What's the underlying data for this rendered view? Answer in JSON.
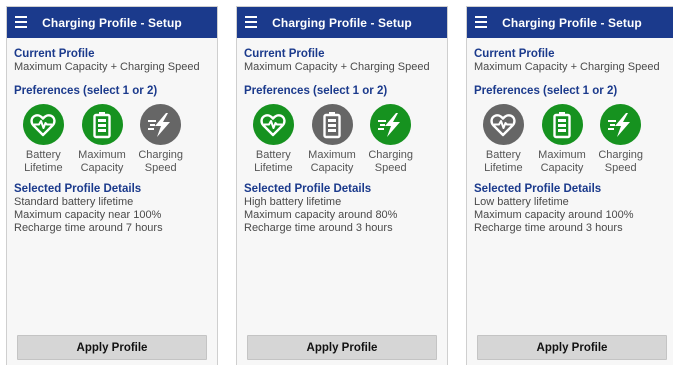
{
  "screens": [
    {
      "app_title": "Charging Profile - Setup",
      "current_profile_heading": "Current Profile",
      "current_profile_value": "Maximum Capacity + Charging Speed",
      "preferences_heading": "Preferences (select 1 or 2)",
      "preferences": [
        {
          "label_line1": "Battery",
          "label_line2": "Lifetime",
          "icon": "heart-pulse-icon",
          "selected": true
        },
        {
          "label_line1": "Maximum",
          "label_line2": "Capacity",
          "icon": "battery-icon",
          "selected": true
        },
        {
          "label_line1": "Charging",
          "label_line2": "Speed",
          "icon": "lightning-speed-icon",
          "selected": false
        }
      ],
      "details_heading": "Selected Profile Details",
      "details": [
        "Standard battery lifetime",
        "Maximum capacity near 100%",
        "Recharge time around 7 hours"
      ],
      "apply_label": "Apply Profile"
    },
    {
      "app_title": "Charging Profile - Setup",
      "current_profile_heading": "Current Profile",
      "current_profile_value": "Maximum Capacity + Charging Speed",
      "preferences_heading": "Preferences (select 1 or 2)",
      "preferences": [
        {
          "label_line1": "Battery",
          "label_line2": "Lifetime",
          "icon": "heart-pulse-icon",
          "selected": true
        },
        {
          "label_line1": "Maximum",
          "label_line2": "Capacity",
          "icon": "battery-icon",
          "selected": false
        },
        {
          "label_line1": "Charging",
          "label_line2": "Speed",
          "icon": "lightning-speed-icon",
          "selected": true
        }
      ],
      "details_heading": "Selected Profile Details",
      "details": [
        "High battery lifetime",
        "Maximum capacity around 80%",
        "Recharge time around 3 hours"
      ],
      "apply_label": "Apply Profile"
    },
    {
      "app_title": "Charging Profile - Setup",
      "current_profile_heading": "Current Profile",
      "current_profile_value": "Maximum Capacity + Charging Speed",
      "preferences_heading": "Preferences (select 1 or 2)",
      "preferences": [
        {
          "label_line1": "Battery",
          "label_line2": "Lifetime",
          "icon": "heart-pulse-icon",
          "selected": false
        },
        {
          "label_line1": "Maximum",
          "label_line2": "Capacity",
          "icon": "battery-icon",
          "selected": true
        },
        {
          "label_line1": "Charging",
          "label_line2": "Speed",
          "icon": "lightning-speed-icon",
          "selected": true
        }
      ],
      "details_heading": "Selected Profile Details",
      "details": [
        "Low battery lifetime",
        "Maximum capacity around 100%",
        "Recharge time around 3 hours"
      ],
      "apply_label": "Apply Profile"
    }
  ],
  "colors": {
    "topbar": "#1b3a8c",
    "heading": "#1b3a8c",
    "selected": "#16921f",
    "unselected": "#666666",
    "button": "#d6d6d6"
  }
}
